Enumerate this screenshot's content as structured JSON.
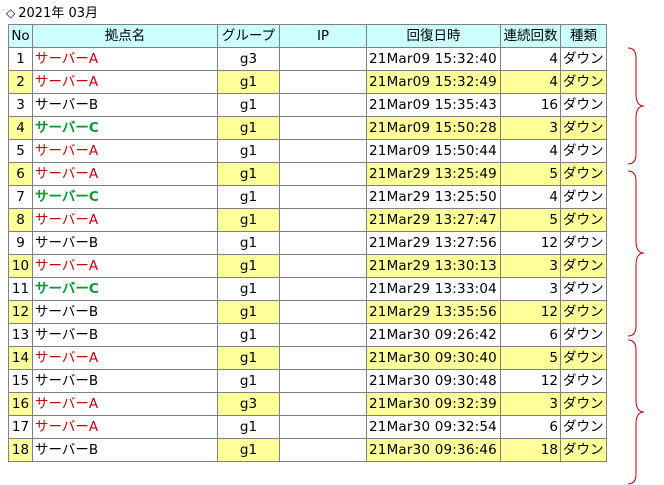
{
  "page": {
    "diamond": "◇",
    "title": "2021年 03月"
  },
  "table": {
    "headers": {
      "no": "No",
      "site": "拠点名",
      "group": "グループ",
      "ip": "IP",
      "time": "回復日時",
      "count": "連続回数",
      "type": "種類"
    },
    "rows": [
      {
        "no": "1",
        "site": "サーバーA",
        "site_color": "red",
        "group": "g3",
        "ip": "",
        "time": "21Mar09 15:32:40",
        "count": "4",
        "type": "ダウン"
      },
      {
        "no": "2",
        "site": "サーバーA",
        "site_color": "red",
        "group": "g1",
        "ip": "",
        "time": "21Mar09 15:32:49",
        "count": "4",
        "type": "ダウン"
      },
      {
        "no": "3",
        "site": "サーバーB",
        "site_color": "black",
        "group": "g1",
        "ip": "",
        "time": "21Mar09 15:35:43",
        "count": "16",
        "type": "ダウン"
      },
      {
        "no": "4",
        "site": "サーバーC",
        "site_color": "green",
        "group": "g1",
        "ip": "",
        "time": "21Mar09 15:50:28",
        "count": "3",
        "type": "ダウン"
      },
      {
        "no": "5",
        "site": "サーバーA",
        "site_color": "red",
        "group": "g1",
        "ip": "",
        "time": "21Mar09 15:50:44",
        "count": "4",
        "type": "ダウン"
      },
      {
        "no": "6",
        "site": "サーバーA",
        "site_color": "red",
        "group": "g1",
        "ip": "",
        "time": "21Mar29 13:25:49",
        "count": "5",
        "type": "ダウン"
      },
      {
        "no": "7",
        "site": "サーバーC",
        "site_color": "green",
        "group": "g1",
        "ip": "",
        "time": "21Mar29 13:25:50",
        "count": "4",
        "type": "ダウン"
      },
      {
        "no": "8",
        "site": "サーバーA",
        "site_color": "red",
        "group": "g1",
        "ip": "",
        "time": "21Mar29 13:27:47",
        "count": "5",
        "type": "ダウン"
      },
      {
        "no": "9",
        "site": "サーバーB",
        "site_color": "black",
        "group": "g1",
        "ip": "",
        "time": "21Mar29 13:27:56",
        "count": "12",
        "type": "ダウン"
      },
      {
        "no": "10",
        "site": "サーバーA",
        "site_color": "red",
        "group": "g1",
        "ip": "",
        "time": "21Mar29 13:30:13",
        "count": "3",
        "type": "ダウン"
      },
      {
        "no": "11",
        "site": "サーバーC",
        "site_color": "green",
        "group": "g1",
        "ip": "",
        "time": "21Mar29 13:33:04",
        "count": "3",
        "type": "ダウン"
      },
      {
        "no": "12",
        "site": "サーバーB",
        "site_color": "black",
        "group": "g1",
        "ip": "",
        "time": "21Mar29 13:35:56",
        "count": "12",
        "type": "ダウン"
      },
      {
        "no": "13",
        "site": "サーバーB",
        "site_color": "black",
        "group": "g1",
        "ip": "",
        "time": "21Mar30 09:26:42",
        "count": "6",
        "type": "ダウン"
      },
      {
        "no": "14",
        "site": "サーバーA",
        "site_color": "red",
        "group": "g1",
        "ip": "",
        "time": "21Mar30 09:30:40",
        "count": "5",
        "type": "ダウン"
      },
      {
        "no": "15",
        "site": "サーバーB",
        "site_color": "black",
        "group": "g1",
        "ip": "",
        "time": "21Mar30 09:30:48",
        "count": "12",
        "type": "ダウン"
      },
      {
        "no": "16",
        "site": "サーバーA",
        "site_color": "red",
        "group": "g3",
        "ip": "",
        "time": "21Mar30 09:32:39",
        "count": "3",
        "type": "ダウン"
      },
      {
        "no": "17",
        "site": "サーバーA",
        "site_color": "red",
        "group": "g1",
        "ip": "",
        "time": "21Mar30 09:32:54",
        "count": "6",
        "type": "ダウン"
      },
      {
        "no": "18",
        "site": "サーバーB",
        "site_color": "black",
        "group": "g1",
        "ip": "",
        "time": "21Mar30 09:36:46",
        "count": "18",
        "type": "ダウン"
      }
    ]
  },
  "colors": {
    "header_bg": "#ccffff",
    "highlight_bg": "#ffff99",
    "grid": "#808080",
    "site_red": "#cc0000",
    "site_green": "#009933",
    "bracket": "#cc0000"
  }
}
